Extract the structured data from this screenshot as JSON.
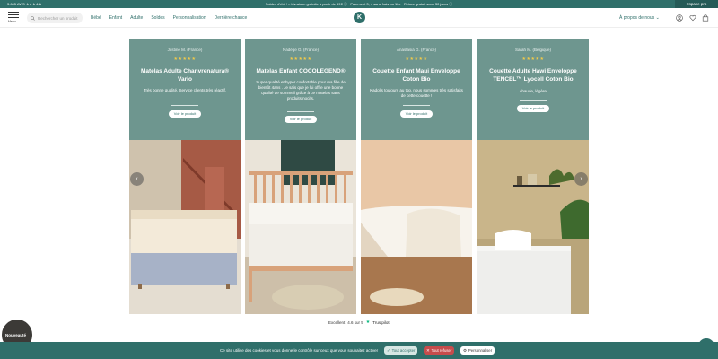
{
  "topbar": {
    "left": "3.665 AVIS ★★★★★",
    "center": "Soldes d'été ! – Livraison gratuite à partir de 69€ ⓘ · Paiement 3, 4 sans frais ou 10x · Retour gratuit sous 30 jours ⓘ",
    "right": "Espace pro"
  },
  "header": {
    "menu_label": "Menu",
    "search_placeholder": "Rechercher un produit",
    "nav": [
      "Bébé",
      "Enfant",
      "Adulte",
      "Soldes",
      "Personnalisation",
      "Dernière chance"
    ],
    "logo": "K",
    "about": "À propos de nous"
  },
  "cards": [
    {
      "author": "Justine M. (France)",
      "stars": "★★★★★",
      "title": "Matelas Adulte Chanvrenatura® Vario",
      "review": "Très bonne qualité. Service clients très réactif.",
      "button": "Voir le produit"
    },
    {
      "author": "Nadège G. (France)",
      "stars": "★★★★★",
      "title": "Matelas Enfant COCOLEGEND®",
      "review": "Super qualité et hyper confortable pour ma fille de bientôt 4ans . Je sais que je lui offre une bonne qualité de sommeil grâce à ce matelas sans produits nocifs.",
      "button": "Voir le produit"
    },
    {
      "author": "Anastasia G. (France)",
      "stars": "★★★★★",
      "title": "Couette Enfant Maui Enveloppe Coton Bio",
      "review": "Kadolis toujours au top, nous sommes très satisfaits de cette couette !",
      "button": "Voir le produit"
    },
    {
      "author": "Sarah M. (Belgique)",
      "stars": "★★★★★",
      "title": "Couette Adulte Hawi Enveloppe TENCEL™ Lyocell Coton Bio",
      "review": "chaude, légère",
      "button": "Voir le produit"
    }
  ],
  "trustpilot": {
    "label": "Excellent",
    "score": "4.6 sur 5",
    "brand": "Trustpilot"
  },
  "avatar_label": "Nouveauté",
  "cookie": {
    "message": "Ce site utilise des cookies et vous donne le contrôle sur ceux que vous souhaitez activer",
    "accept": "Tout accepter",
    "refuse": "Tout refuser",
    "customize": "Personnaliser"
  },
  "colors": {
    "brand": "#2f6f6a",
    "card": "#6e968f",
    "stars": "#f0c94a"
  }
}
